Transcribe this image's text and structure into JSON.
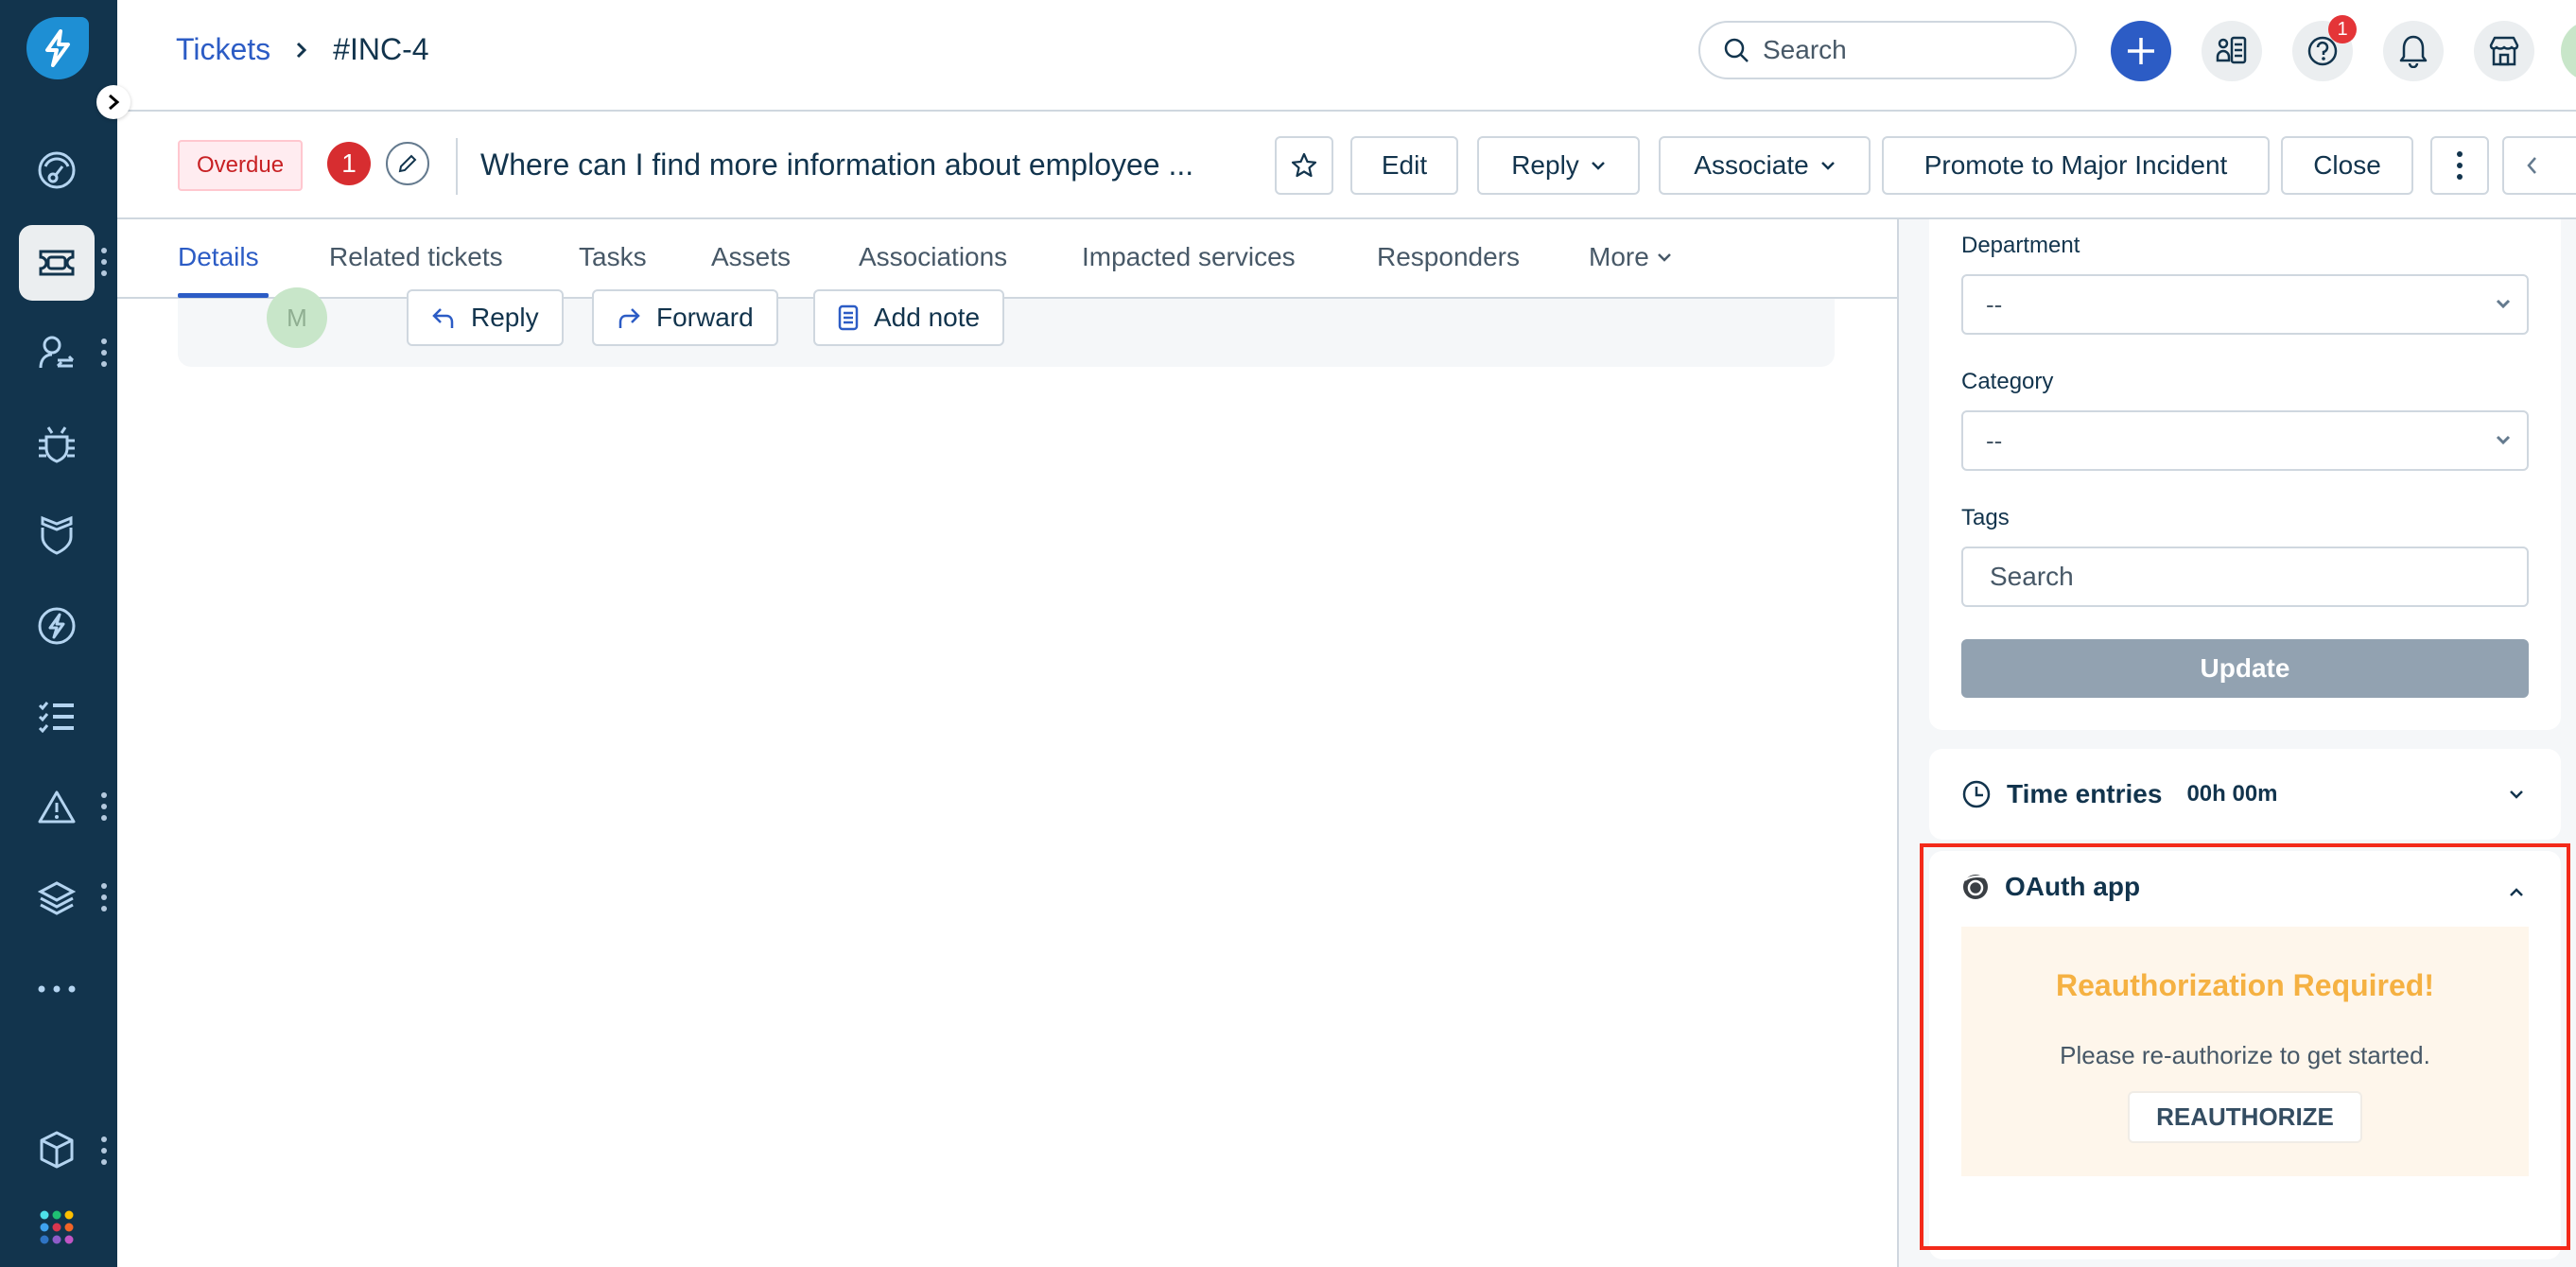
{
  "sidebar": {
    "logo": "freshservice-logo-icon",
    "toggle": "chevron-right-icon",
    "items": [
      {
        "icon": "dashboard-icon",
        "label": "Dashboard",
        "active": false,
        "menu": false
      },
      {
        "icon": "ticket-icon",
        "label": "Tickets",
        "active": true,
        "menu": true
      },
      {
        "icon": "agent-transfer-icon",
        "label": "Changes",
        "active": false,
        "menu": true
      },
      {
        "icon": "bug-icon",
        "label": "Problems",
        "active": false,
        "menu": false
      },
      {
        "icon": "shield-icon",
        "label": "Releases",
        "active": false,
        "menu": false
      },
      {
        "icon": "bolt-icon",
        "label": "Alerts",
        "active": false,
        "menu": false
      },
      {
        "icon": "checklist-icon",
        "label": "Tasks",
        "active": false,
        "menu": false
      },
      {
        "icon": "warning-icon",
        "label": "Incidents",
        "active": false,
        "menu": true
      },
      {
        "icon": "layers-icon",
        "label": "Assets",
        "active": false,
        "menu": true
      },
      {
        "icon": "more-dots-icon",
        "label": "More",
        "active": false,
        "menu": false
      },
      {
        "icon": "cube-icon",
        "label": "Apps",
        "active": false,
        "menu": true
      },
      {
        "icon": "app-grid-icon",
        "label": "Apps switcher",
        "active": false,
        "menu": false
      }
    ]
  },
  "header": {
    "breadcrumb": {
      "parent": "Tickets",
      "separator": "›",
      "current": "#INC-4"
    },
    "search_placeholder": "Search",
    "help_badge": "1"
  },
  "ticket": {
    "status_tag": "Overdue",
    "count_badge": "1",
    "subject": "Where can I find more information about employee ...",
    "actions": {
      "edit": "Edit",
      "reply": "Reply",
      "associate": "Associate",
      "promote": "Promote to Major Incident",
      "close": "Close"
    }
  },
  "tabs": [
    {
      "label": "Details",
      "active": true
    },
    {
      "label": "Related tickets",
      "active": false
    },
    {
      "label": "Tasks",
      "active": false
    },
    {
      "label": "Assets",
      "active": false
    },
    {
      "label": "Associations",
      "active": false
    },
    {
      "label": "Impacted services",
      "active": false
    },
    {
      "label": "Responders",
      "active": false
    },
    {
      "label": "More",
      "active": false
    }
  ],
  "reply_bar": {
    "avatar_initial": "M",
    "reply": "Reply",
    "forward": "Forward",
    "add_note": "Add note"
  },
  "properties": {
    "department": {
      "label": "Department",
      "value": "--"
    },
    "category": {
      "label": "Category",
      "value": "--"
    },
    "tags": {
      "label": "Tags",
      "placeholder": "Search"
    },
    "update_label": "Update"
  },
  "time_entries": {
    "label": "Time entries",
    "value": "00h 00m"
  },
  "oauth_app": {
    "title": "OAuth app",
    "heading": "Reauthorization Required!",
    "message": "Please re-authorize to get started.",
    "button": "REAUTHORIZE",
    "heading_color": "#f5b142",
    "highlight_color": "#f32a1a"
  }
}
